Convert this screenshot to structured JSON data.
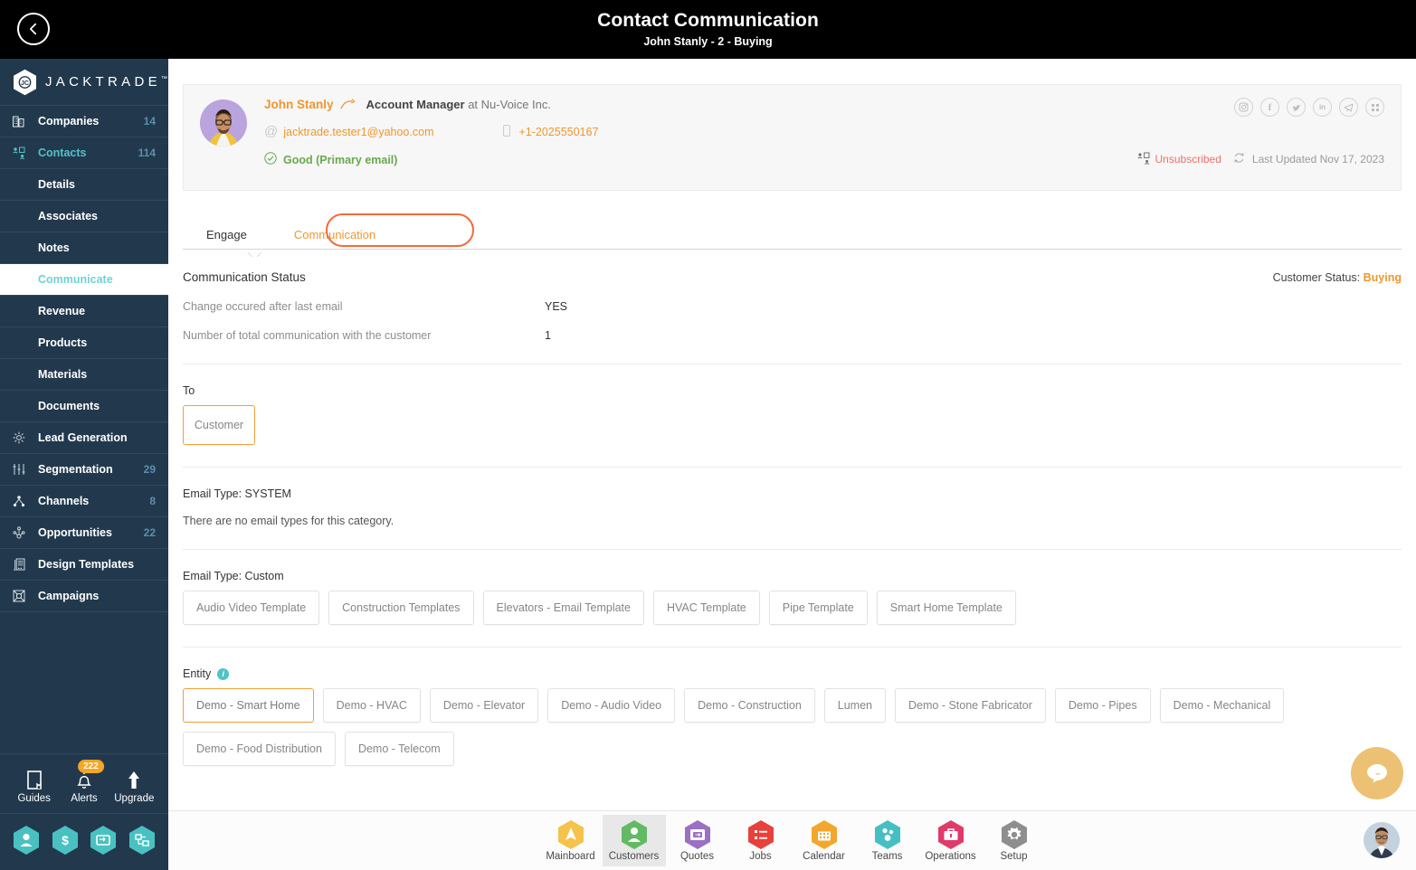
{
  "topbar": {
    "title": "Contact Communication",
    "subtitle": "John Stanly - 2 - Buying",
    "back_icon": "chevron-left-icon"
  },
  "sidebar": {
    "brand": "JACKTRADE",
    "brand_tm": "™",
    "items": [
      {
        "label": "Companies",
        "count": "14",
        "icon": "building-icon",
        "type": "top"
      },
      {
        "label": "Contacts",
        "count": "114",
        "icon": "contacts-icon",
        "type": "top-active"
      },
      {
        "label": "Details",
        "count": "",
        "icon": "",
        "type": "sub"
      },
      {
        "label": "Associates",
        "count": "",
        "icon": "",
        "type": "sub"
      },
      {
        "label": "Notes",
        "count": "",
        "icon": "",
        "type": "sub"
      },
      {
        "label": "Communicate",
        "count": "",
        "icon": "",
        "type": "sub-active"
      },
      {
        "label": "Revenue",
        "count": "",
        "icon": "",
        "type": "sub"
      },
      {
        "label": "Products",
        "count": "",
        "icon": "",
        "type": "sub"
      },
      {
        "label": "Materials",
        "count": "",
        "icon": "",
        "type": "sub"
      },
      {
        "label": "Documents",
        "count": "",
        "icon": "",
        "type": "sub"
      },
      {
        "label": "Lead Generation",
        "count": "",
        "icon": "lead-generation-icon",
        "type": "top"
      },
      {
        "label": "Segmentation",
        "count": "29",
        "icon": "segmentation-icon",
        "type": "top"
      },
      {
        "label": "Channels",
        "count": "8",
        "icon": "channels-icon",
        "type": "top"
      },
      {
        "label": "Opportunities",
        "count": "22",
        "icon": "opportunities-icon",
        "type": "top"
      },
      {
        "label": "Design Templates",
        "count": "",
        "icon": "design-templates-icon",
        "type": "top"
      },
      {
        "label": "Campaigns",
        "count": "",
        "icon": "campaigns-icon",
        "type": "top"
      }
    ],
    "tools": [
      {
        "label": "Guides",
        "icon": "book-icon",
        "badge": ""
      },
      {
        "label": "Alerts",
        "icon": "bell-icon",
        "badge": "222"
      },
      {
        "label": "Upgrade",
        "icon": "arrow-up-icon",
        "badge": ""
      }
    ],
    "quick_hex": [
      {
        "icon": "person-hex-icon"
      },
      {
        "icon": "dollar-hex-icon"
      },
      {
        "icon": "card-hex-icon"
      },
      {
        "icon": "workflow-hex-icon"
      }
    ]
  },
  "contact": {
    "name": "John Stanly",
    "role": "Account Manager",
    "at": " at ",
    "company": "Nu-Voice Inc.",
    "email": "jacktrade.tester1@yahoo.com",
    "phone": "+1-2025550167",
    "email_quality": "Good",
    "email_quality_note": "(Primary email)",
    "socials": [
      {
        "name": "instagram-icon",
        "glyph": "▣"
      },
      {
        "name": "facebook-icon",
        "glyph": "f"
      },
      {
        "name": "twitter-icon",
        "glyph": "✦"
      },
      {
        "name": "linkedin-icon",
        "glyph": "in"
      },
      {
        "name": "telegram-icon",
        "glyph": "➤"
      },
      {
        "name": "apps-grid-icon",
        "glyph": "⠿"
      }
    ],
    "unsubscribed": "Unsubscribed",
    "last_updated": "Last Updated Nov 17, 2023"
  },
  "tabs": [
    {
      "label": "Engage",
      "active": false
    },
    {
      "label": "Communication",
      "active": true
    }
  ],
  "status": {
    "section_title": "Communication Status",
    "customer_status_label": "Customer Status:",
    "customer_status_value": "Buying",
    "rows": [
      {
        "key": "Change occured after last email",
        "value": "YES"
      },
      {
        "key": "Number of total communication with the customer",
        "value": "1"
      }
    ]
  },
  "to": {
    "label": "To",
    "chips": [
      "Customer"
    ]
  },
  "email_type_system": {
    "label": "Email Type: SYSTEM",
    "empty": "There are no email types for this category."
  },
  "email_type_custom": {
    "label": "Email Type: Custom",
    "chips": [
      "Audio Video Template",
      "Construction Templates",
      "Elevators - Email Template",
      "HVAC Template",
      "Pipe Template",
      "Smart Home Template"
    ]
  },
  "entity": {
    "label": "Entity",
    "info_icon": "info-icon",
    "chips": [
      {
        "label": "Demo - Smart Home",
        "selected": true
      },
      {
        "label": "Demo - HVAC",
        "selected": false
      },
      {
        "label": "Demo - Elevator",
        "selected": false
      },
      {
        "label": "Demo - Audio Video",
        "selected": false
      },
      {
        "label": "Demo - Construction",
        "selected": false
      },
      {
        "label": "Lumen",
        "selected": false
      },
      {
        "label": "Demo - Stone Fabricator",
        "selected": false
      },
      {
        "label": "Demo - Pipes",
        "selected": false
      },
      {
        "label": "Demo - Mechanical",
        "selected": false
      },
      {
        "label": "Demo - Food Distribution",
        "selected": false
      },
      {
        "label": "Demo - Telecom",
        "selected": false
      }
    ]
  },
  "bottom_nav": [
    {
      "label": "Mainboard",
      "icon": "mainboard-hex-icon",
      "color": "#f5c24b",
      "active": false
    },
    {
      "label": "Customers",
      "icon": "customers-hex-icon",
      "color": "#62bb62",
      "active": true
    },
    {
      "label": "Quotes",
      "icon": "quotes-hex-icon",
      "color": "#9b6fc4",
      "active": false
    },
    {
      "label": "Jobs",
      "icon": "jobs-hex-icon",
      "color": "#e8413c",
      "active": false
    },
    {
      "label": "Calendar",
      "icon": "calendar-hex-icon",
      "color": "#f2a72c",
      "active": false
    },
    {
      "label": "Teams",
      "icon": "teams-hex-icon",
      "color": "#46bfc4",
      "active": false
    },
    {
      "label": "Operations",
      "icon": "operations-hex-icon",
      "color": "#e03a68",
      "active": false
    },
    {
      "label": "Setup",
      "icon": "setup-hex-icon",
      "color": "#8e8e8e",
      "active": false
    }
  ],
  "chat_widget": {
    "icon": "chat-bubble-icon",
    "color": "#edc173"
  },
  "colors": {
    "sidebar_bg": "#22394d",
    "accent_orange": "#f0962e",
    "tab_ring": "#f26b38",
    "teal": "#4fc3c7",
    "green": "#6aa84f",
    "red": "#f07067"
  }
}
